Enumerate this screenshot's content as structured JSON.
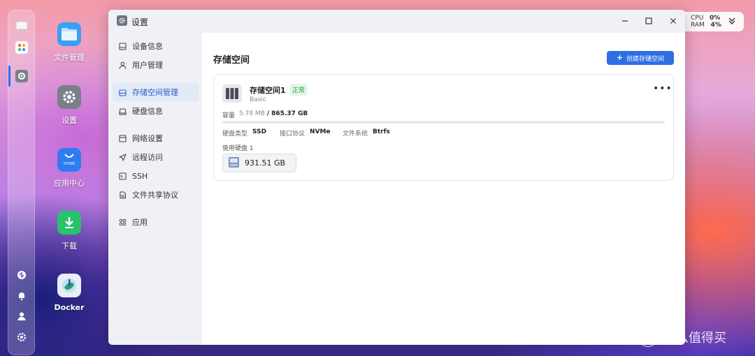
{
  "desktop": {
    "icons": [
      {
        "label": "文件管理",
        "icon": "folder-icon",
        "color": "#3aa0f5"
      },
      {
        "label": "设置",
        "icon": "gear-icon",
        "color": "#7b7f88"
      },
      {
        "label": "应用中心",
        "icon": "store-icon",
        "color": "#2f7cf0",
        "badge": "STORE"
      },
      {
        "label": "下载",
        "icon": "download-icon",
        "color": "#27c26a"
      },
      {
        "label": "Docker",
        "icon": "docker-icon",
        "color": "#e9eef5"
      }
    ]
  },
  "sysmon": {
    "cpu_label": "CPU",
    "cpu_value": "0%",
    "ram_label": "RAM",
    "ram_value": "4%"
  },
  "window": {
    "title": "设置",
    "sidebar": [
      {
        "label": "设备信息",
        "icon": "device-icon"
      },
      {
        "label": "用户管理",
        "icon": "user-icon"
      },
      {
        "label": "存储空间管理",
        "icon": "storage-icon",
        "active": true
      },
      {
        "label": "硬盘信息",
        "icon": "disk-icon"
      },
      {
        "label": "网络设置",
        "icon": "network-icon"
      },
      {
        "label": "远程访问",
        "icon": "send-icon"
      },
      {
        "label": "SSH",
        "icon": "terminal-icon"
      },
      {
        "label": "文件共享协议",
        "icon": "file-icon"
      },
      {
        "label": "应用",
        "icon": "apps-icon"
      }
    ],
    "main": {
      "title": "存储空间",
      "create_button": "创建存储空间",
      "volume": {
        "name": "存储空间1",
        "status": "正常",
        "type": "Basic",
        "capacity_label": "容量",
        "used": "5.78 MB",
        "total": "/ 865.37 GB",
        "usage_fraction": 0.0,
        "disk_type_label": "硬盘类型",
        "disk_type": "SSD",
        "interface_label": "接口协议",
        "interface": "NVMe",
        "fs_label": "文件系统",
        "fs": "Btrfs",
        "disks_label": "使用硬盘 1",
        "disk_size": "931.51 GB"
      }
    }
  },
  "watermark": {
    "badge": "值",
    "text": "什么值得买"
  },
  "colors": {
    "accent": "#2f6fe4",
    "status_ok": "#1fa34a"
  }
}
